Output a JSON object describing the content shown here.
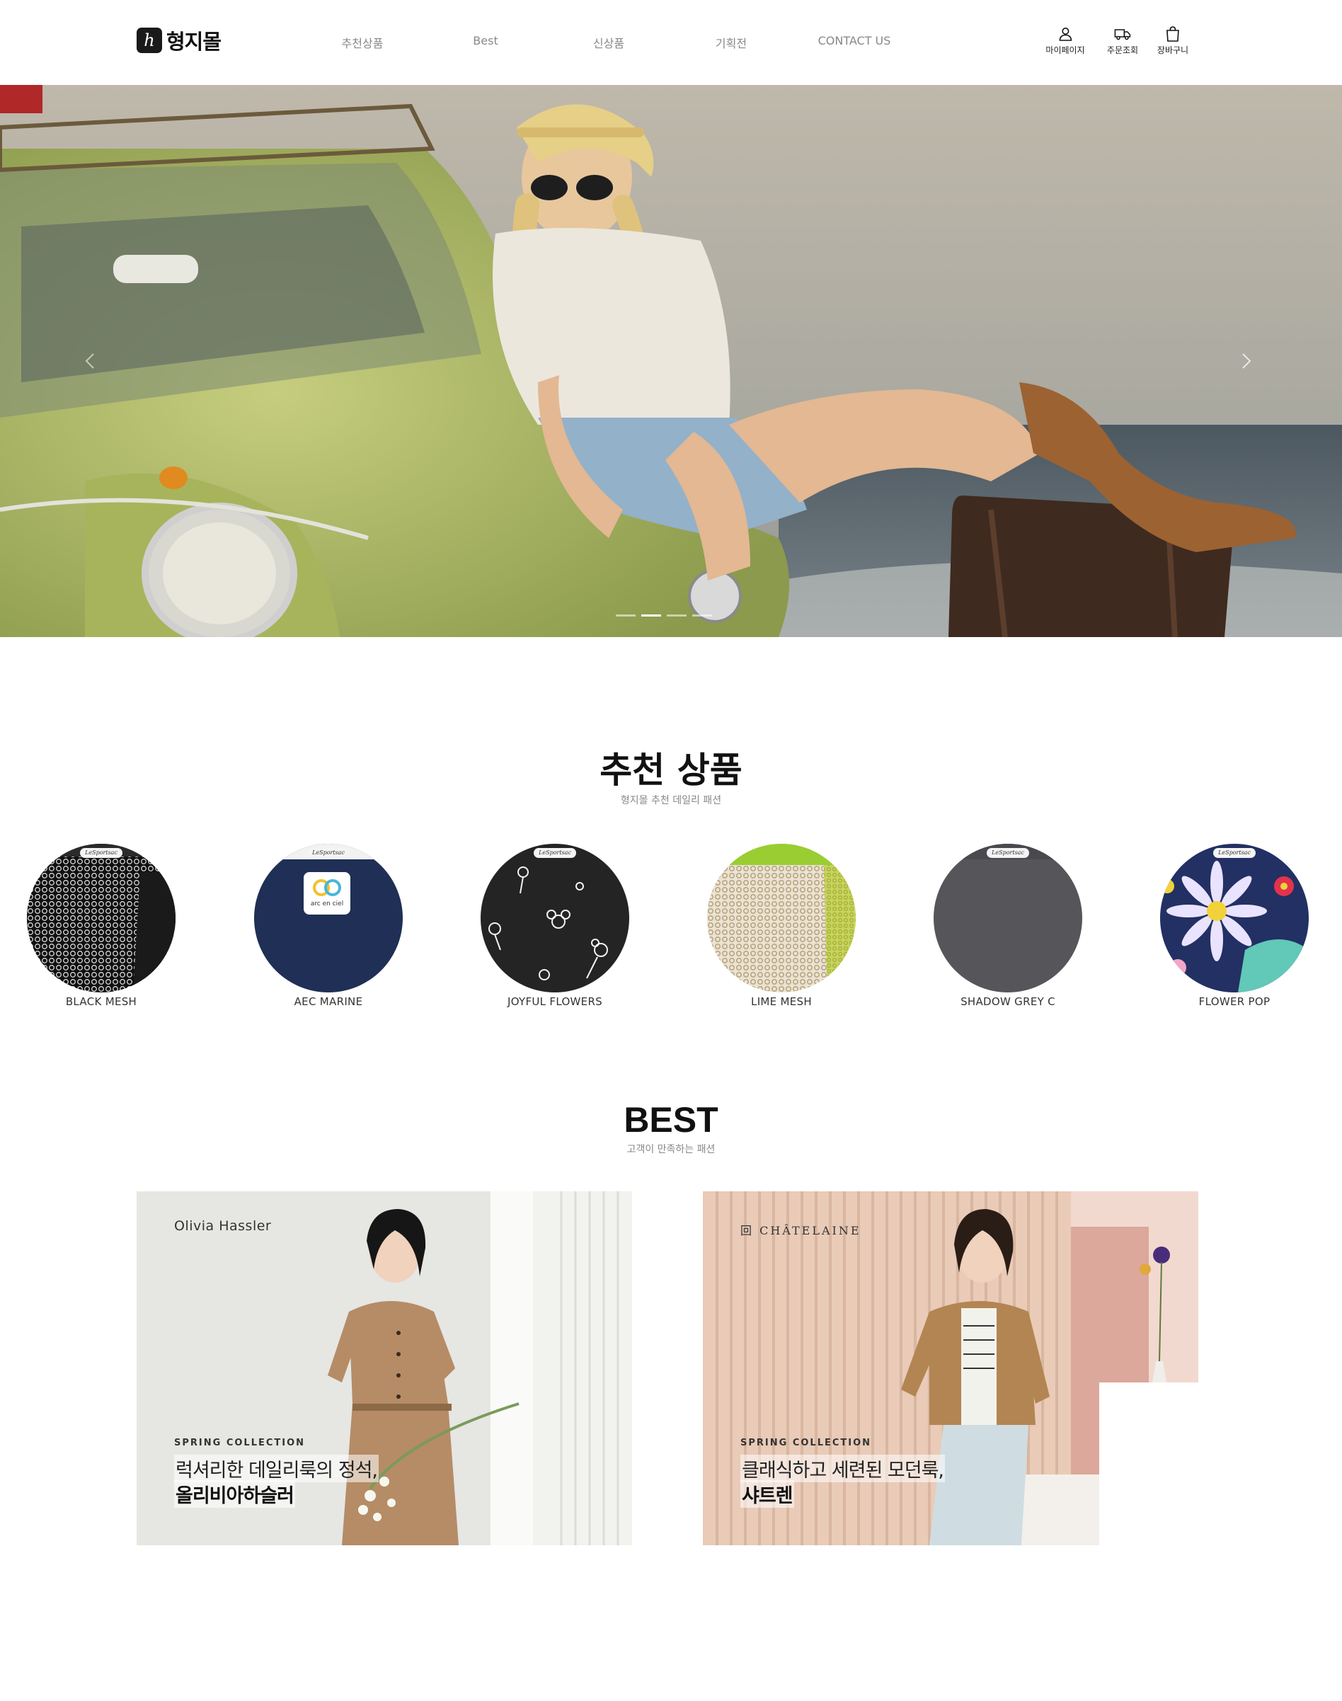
{
  "header": {
    "logo_mark": "h",
    "logo_text": "형지몰",
    "nav": [
      "추천상품",
      "Best",
      "신상품",
      "기획전",
      "CONTACT US"
    ],
    "utilities": [
      {
        "label": "마이페이지",
        "icon": "user-icon"
      },
      {
        "label": "주문조회",
        "icon": "truck-icon"
      },
      {
        "label": "장바구니",
        "icon": "shopping-bag-icon"
      }
    ]
  },
  "hero": {
    "slides": 4,
    "active_slide": 2,
    "prev_icon": "chevron-left-icon",
    "next_icon": "chevron-right-icon"
  },
  "recommend": {
    "title": "추천 상품",
    "subtitle": "형지몰 추천 데일리 패션",
    "items": [
      {
        "label": "BLACK MESH",
        "color": "#1b1b1b"
      },
      {
        "label": "AEC MARINE",
        "color": "#1f2f55"
      },
      {
        "label": "JOYFUL FLOWERS",
        "color": "#222222"
      },
      {
        "label": "LIME MESH",
        "color": "#c9b998"
      },
      {
        "label": "SHADOW GREY C",
        "color": "#56565a"
      },
      {
        "label": "FLOWER POP",
        "color": "#223063"
      }
    ],
    "tag_text": "LeSportsac",
    "aec_badge": "arc en ciel"
  },
  "best": {
    "title": "BEST",
    "subtitle": "고객이 만족하는 패션",
    "banners": [
      {
        "brand": "Olivia Hassler",
        "collection": "SPRING COLLECTION",
        "line1": "럭셔리한 데일리룩의 정석,",
        "line2": "올리비아하슬러"
      },
      {
        "brand": "回 CHÂTELAINE",
        "collection": "SPRING COLLECTION",
        "line1": "클래식하고 세련된 모던룩,",
        "line2": "샤트렌"
      }
    ]
  }
}
